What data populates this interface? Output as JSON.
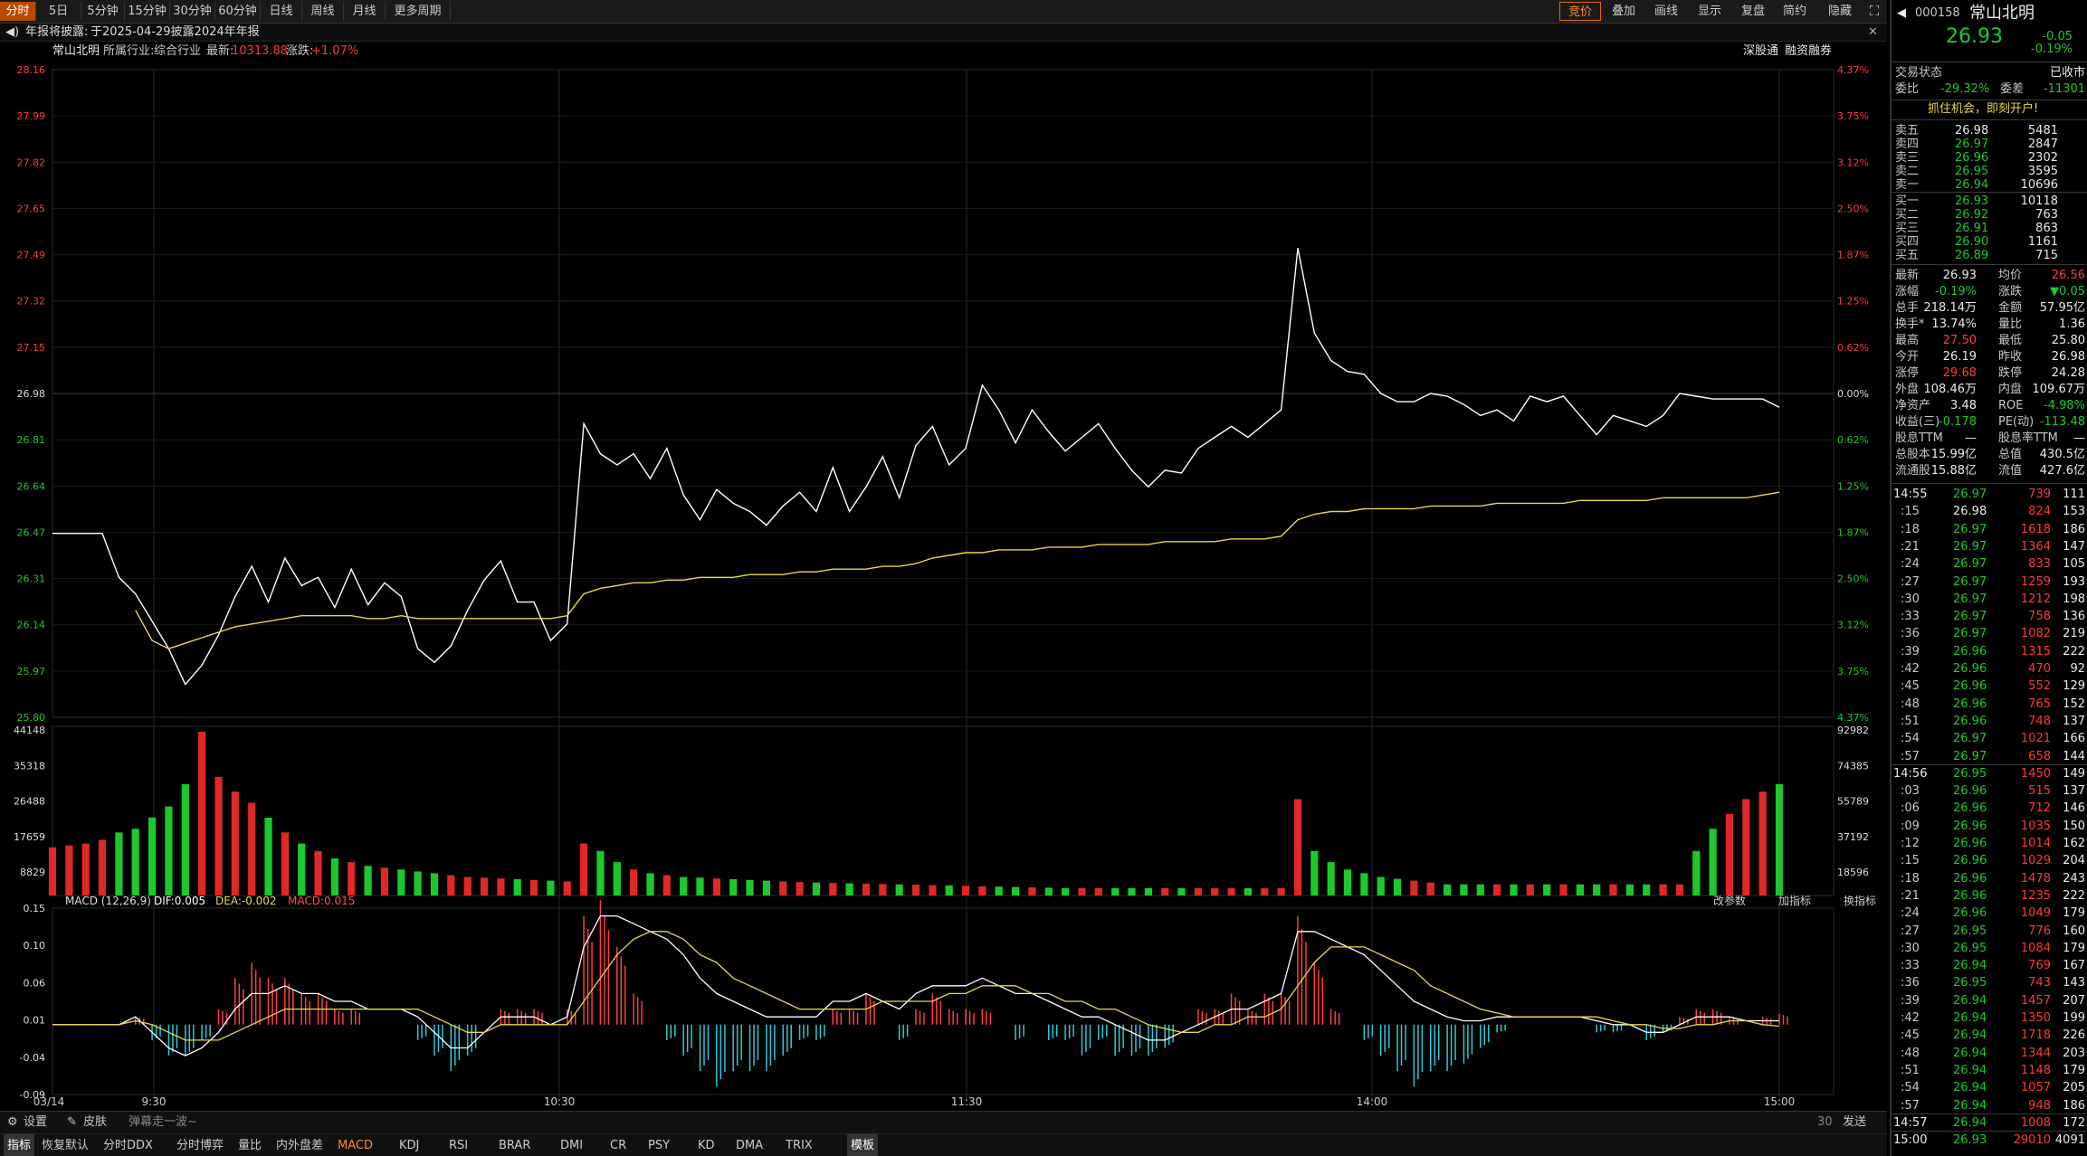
{
  "toolbar": {
    "tabs": [
      "分时",
      "5日",
      "5分钟",
      "15分钟",
      "30分钟",
      "60分钟",
      "日线",
      "周线",
      "月线",
      "更多周期"
    ],
    "right": [
      "竞价",
      "叠加",
      "画线",
      "显示",
      "复盘",
      "简约",
      "隐藏"
    ]
  },
  "notice": {
    "label": "年报将披露:",
    "text": "于2025-04-29披露2024年年报"
  },
  "info": {
    "name": "常山北明",
    "industry_label": "所属行业:",
    "industry": "综合行业",
    "latest_label": "最新:",
    "latest": "10313.88",
    "change_label": "涨跌:",
    "change": "+1.07%",
    "links": [
      "深股通",
      "融资融券"
    ]
  },
  "chart_data": [
    {
      "type": "line",
      "title": "",
      "y_labels": [
        "28.16",
        "27.99",
        "27.82",
        "27.65",
        "27.49",
        "27.32",
        "27.15",
        "26.98",
        "26.81",
        "26.64",
        "26.47",
        "26.31",
        "26.14",
        "25.97",
        "25.80"
      ],
      "pct_labels": [
        "4.37%",
        "3.75%",
        "3.12%",
        "2.50%",
        "1.87%",
        "1.25%",
        "0.62%",
        "0.00%",
        "0.62%",
        "1.25%",
        "1.87%",
        "2.50%",
        "3.12%",
        "3.75%",
        "4.37%"
      ],
      "ylim": [
        25.8,
        28.16
      ],
      "prev_close": 26.98,
      "x_labels": [
        "03/14",
        "9:30",
        "10:30",
        "11:30",
        "14:00",
        "15:00"
      ],
      "series": [
        {
          "name": "",
          "color": "#ffffff",
          "values": [
            26.47,
            26.47,
            26.47,
            26.47,
            26.31,
            26.25,
            26.15,
            26.05,
            25.92,
            25.99,
            26.1,
            26.24,
            26.35,
            26.22,
            26.38,
            26.28,
            26.31,
            26.2,
            26.34,
            26.21,
            26.29,
            26.24,
            26.05,
            26.0,
            26.06,
            26.19,
            26.3,
            26.37,
            26.22,
            26.22,
            26.08,
            26.14,
            26.87,
            26.76,
            26.72,
            26.76,
            26.67,
            26.78,
            26.61,
            26.52,
            26.63,
            26.58,
            26.55,
            26.5,
            26.57,
            26.62,
            26.55,
            26.71,
            26.55,
            26.64,
            26.75,
            26.6,
            26.79,
            26.86,
            26.72,
            26.78,
            27.01,
            26.92,
            26.8,
            26.92,
            26.84,
            26.77,
            26.82,
            26.87,
            26.78,
            26.7,
            26.64,
            26.7,
            26.69,
            26.78,
            26.82,
            26.86,
            26.82,
            26.87,
            26.92,
            27.51,
            27.2,
            27.1,
            27.06,
            27.05,
            26.98,
            26.95,
            26.95,
            26.98,
            26.97,
            26.94,
            26.9,
            26.92,
            26.88,
            26.97,
            26.95,
            26.97,
            26.9,
            26.83,
            26.9,
            26.88,
            26.86,
            26.9,
            26.98,
            26.97,
            26.96,
            26.96,
            26.96,
            26.96,
            26.93
          ]
        },
        {
          "name": "",
          "color": "#e8d84a",
          "values": [
            null,
            null,
            null,
            null,
            null,
            26.19,
            26.08,
            26.05,
            26.07,
            26.09,
            26.11,
            26.13,
            26.14,
            26.15,
            26.16,
            26.17,
            26.17,
            26.17,
            26.17,
            26.16,
            26.16,
            26.17,
            26.16,
            26.16,
            26.16,
            26.16,
            26.16,
            26.16,
            26.16,
            26.16,
            26.16,
            26.17,
            26.25,
            26.27,
            26.28,
            26.29,
            26.29,
            26.3,
            26.3,
            26.31,
            26.31,
            26.31,
            26.32,
            26.32,
            26.32,
            26.33,
            26.33,
            26.34,
            26.34,
            26.34,
            26.35,
            26.35,
            26.36,
            26.38,
            26.39,
            26.4,
            26.4,
            26.41,
            26.41,
            26.41,
            26.42,
            26.42,
            26.42,
            26.43,
            26.43,
            26.43,
            26.43,
            26.44,
            26.44,
            26.44,
            26.44,
            26.45,
            26.45,
            26.45,
            26.46,
            26.52,
            26.54,
            26.55,
            26.55,
            26.56,
            26.56,
            26.56,
            26.56,
            26.57,
            26.57,
            26.57,
            26.57,
            26.58,
            26.58,
            26.58,
            26.58,
            26.58,
            26.59,
            26.59,
            26.59,
            26.59,
            26.59,
            26.6,
            26.6,
            26.6,
            26.6,
            26.6,
            26.6,
            26.61,
            26.62
          ]
        }
      ]
    },
    {
      "type": "bar",
      "title": "",
      "y_labels": [
        "44148",
        "35318",
        "26488",
        "17659",
        "8829"
      ],
      "right_labels": [
        "92982",
        "74385",
        "55789",
        "37192",
        "18596"
      ],
      "ylim": [
        0,
        44148
      ],
      "values": [
        13000,
        13500,
        14000,
        15000,
        17000,
        18000,
        21000,
        24000,
        30000,
        44148,
        32000,
        28000,
        25000,
        21000,
        17000,
        14000,
        12000,
        10000,
        9000,
        8000,
        7500,
        7000,
        6500,
        6000,
        5500,
        5000,
        4800,
        4600,
        4400,
        4200,
        4000,
        3800,
        14000,
        12000,
        9000,
        7000,
        6000,
        5500,
        5000,
        4800,
        4600,
        4400,
        4200,
        4000,
        3800,
        3600,
        3500,
        3400,
        3300,
        3200,
        3100,
        3000,
        2900,
        2800,
        2700,
        2600,
        2500,
        2400,
        2300,
        2200,
        2100,
        2000,
        2000,
        2000,
        2000,
        2000,
        2000,
        2000,
        2000,
        2000,
        2000,
        2000,
        2000,
        2000,
        2000,
        26000,
        12000,
        9000,
        7000,
        6000,
        5000,
        4500,
        4000,
        3500,
        3000,
        3000,
        3000,
        3000,
        3000,
        3000,
        3000,
        3000,
        3000,
        3000,
        3000,
        3000,
        3000,
        3000,
        3000,
        12000,
        18000,
        22000,
        26000,
        28000,
        30000
      ]
    },
    {
      "type": "line",
      "title": "MACD (12,26,9)",
      "legend": {
        "dif": "DIF:0.005",
        "dea": "DEA:-0.002",
        "macd": "MACD:0.015"
      },
      "y_labels": [
        "0.15",
        "0.10",
        "0.06",
        "0.01",
        "-0.04",
        "-0.09"
      ],
      "ylim": [
        -0.09,
        0.15
      ],
      "dif": [
        0,
        0,
        0,
        0,
        0,
        0.01,
        -0.01,
        -0.03,
        -0.04,
        -0.03,
        -0.01,
        0.02,
        0.04,
        0.04,
        0.05,
        0.04,
        0.04,
        0.03,
        0.03,
        0.02,
        0.02,
        0.02,
        0.01,
        -0.01,
        -0.03,
        -0.03,
        -0.01,
        0.01,
        0.01,
        0.01,
        0,
        0.01,
        0.1,
        0.14,
        0.14,
        0.13,
        0.12,
        0.11,
        0.09,
        0.06,
        0.04,
        0.03,
        0.02,
        0.01,
        0.01,
        0.01,
        0.01,
        0.03,
        0.03,
        0.04,
        0.03,
        0.02,
        0.04,
        0.05,
        0.05,
        0.05,
        0.06,
        0.05,
        0.04,
        0.04,
        0.03,
        0.02,
        0.01,
        0.01,
        0,
        -0.01,
        -0.02,
        -0.02,
        -0.01,
        0,
        0.01,
        0.02,
        0.02,
        0.03,
        0.04,
        0.12,
        0.12,
        0.11,
        0.1,
        0.09,
        0.07,
        0.05,
        0.03,
        0.02,
        0.01,
        0.005,
        0.005,
        0.01,
        0.01,
        0.01,
        0.01,
        0.01,
        0.01,
        0.005,
        0,
        0,
        -0.01,
        -0.01,
        0,
        0.01,
        0.01,
        0.01,
        0.005,
        0.005,
        0.005
      ],
      "dea": [
        0,
        0,
        0,
        0,
        0,
        0.005,
        0,
        -0.01,
        -0.02,
        -0.02,
        -0.02,
        -0.01,
        0,
        0.01,
        0.02,
        0.02,
        0.02,
        0.02,
        0.02,
        0.02,
        0.02,
        0.02,
        0.02,
        0.01,
        0,
        -0.01,
        -0.01,
        0,
        0,
        0,
        0,
        0,
        0.03,
        0.06,
        0.09,
        0.11,
        0.12,
        0.12,
        0.11,
        0.09,
        0.08,
        0.06,
        0.05,
        0.04,
        0.03,
        0.02,
        0.02,
        0.02,
        0.02,
        0.02,
        0.03,
        0.03,
        0.03,
        0.03,
        0.04,
        0.04,
        0.05,
        0.05,
        0.05,
        0.04,
        0.04,
        0.03,
        0.03,
        0.02,
        0.02,
        0.01,
        0,
        -0.005,
        -0.01,
        -0.01,
        0,
        0,
        0.01,
        0.01,
        0.02,
        0.05,
        0.08,
        0.1,
        0.1,
        0.1,
        0.09,
        0.08,
        0.07,
        0.05,
        0.04,
        0.03,
        0.02,
        0.015,
        0.01,
        0.01,
        0.01,
        0.01,
        0.01,
        0.01,
        0.005,
        0,
        0,
        -0.005,
        -0.005,
        0,
        0,
        0.005,
        0.005,
        0,
        -0.002
      ]
    }
  ],
  "bottom": {
    "row1": [
      "设置",
      "皮肤"
    ],
    "ticker_text": "弹幕走一波~",
    "count": "30",
    "send": "发送",
    "tabs": [
      "指标",
      "恢复默认",
      "分时DDX",
      "分时博弈",
      "量比",
      "内外盘差",
      "MACD",
      "KDJ",
      "RSI",
      "BRAR",
      "DMI",
      "CR",
      "PSY",
      "KD",
      "DMA",
      "TRIX",
      "模板"
    ],
    "macd_buttons": [
      "改参数",
      "加指标",
      "换指标"
    ]
  },
  "side": {
    "code": "000158",
    "name": "常山北明",
    "price": "26.93",
    "change": "-0.05",
    "pct": "-0.19%",
    "status_label": "交易状态",
    "status": "已收市",
    "wb_label": "委比",
    "wb": "-29.32%",
    "wc_label": "委差",
    "wc": "-11301",
    "promo": "抓住机会，即刻开户!",
    "asks": [
      {
        "l": "卖五",
        "p": "26.98",
        "v": "5481"
      },
      {
        "l": "卖四",
        "p": "26.97",
        "v": "2847"
      },
      {
        "l": "卖三",
        "p": "26.96",
        "v": "2302"
      },
      {
        "l": "卖二",
        "p": "26.95",
        "v": "3595"
      },
      {
        "l": "卖一",
        "p": "26.94",
        "v": "10696"
      }
    ],
    "bids": [
      {
        "l": "买一",
        "p": "26.93",
        "v": "10118"
      },
      {
        "l": "买二",
        "p": "26.92",
        "v": "763"
      },
      {
        "l": "买三",
        "p": "26.91",
        "v": "863"
      },
      {
        "l": "买四",
        "p": "26.90",
        "v": "1161"
      },
      {
        "l": "买五",
        "p": "26.89",
        "v": "715"
      }
    ],
    "stats": [
      [
        "最新",
        "26.93",
        "均价",
        "26.56"
      ],
      [
        "涨幅",
        "-0.19%",
        "涨跌",
        "▼0.05"
      ],
      [
        "总手",
        "218.14万",
        "金额",
        "57.95亿"
      ],
      [
        "换手*",
        "13.74%",
        "量比",
        "1.36"
      ],
      [
        "最高",
        "27.50",
        "最低",
        "25.80"
      ],
      [
        "今开",
        "26.19",
        "昨收",
        "26.98"
      ],
      [
        "涨停",
        "29.68",
        "跌停",
        "24.28"
      ],
      [
        "外盘",
        "108.46万",
        "内盘",
        "109.67万"
      ],
      [
        "净资产",
        "3.48",
        "ROE",
        "-4.98%"
      ],
      [
        "收益(三)",
        "-0.178",
        "PE(动)",
        "-113.48"
      ],
      [
        "股息TTM",
        "—",
        "股息率TTM",
        "—"
      ],
      [
        "总股本",
        "15.99亿",
        "总值",
        "430.5亿"
      ],
      [
        "流通股",
        "15.88亿",
        "流值",
        "427.6亿"
      ]
    ],
    "trades": [
      [
        "14:55",
        "26.97",
        "739",
        "111"
      ],
      [
        ":15",
        "26.98",
        "824",
        "153"
      ],
      [
        ":18",
        "26.97",
        "1618",
        "186"
      ],
      [
        ":21",
        "26.97",
        "1364",
        "147"
      ],
      [
        ":24",
        "26.97",
        "833",
        "105"
      ],
      [
        ":27",
        "26.97",
        "1259",
        "193"
      ],
      [
        ":30",
        "26.97",
        "1212",
        "198"
      ],
      [
        ":33",
        "26.97",
        "758",
        "136"
      ],
      [
        ":36",
        "26.97",
        "1082",
        "219"
      ],
      [
        ":39",
        "26.96",
        "1315",
        "222"
      ],
      [
        ":42",
        "26.96",
        "470",
        "92"
      ],
      [
        ":45",
        "26.96",
        "552",
        "129"
      ],
      [
        ":48",
        "26.96",
        "765",
        "152"
      ],
      [
        ":51",
        "26.96",
        "748",
        "137"
      ],
      [
        ":54",
        "26.97",
        "1021",
        "166"
      ],
      [
        ":57",
        "26.97",
        "658",
        "144"
      ],
      [
        "14:56",
        "26.95",
        "1450",
        "149"
      ],
      [
        ":03",
        "26.96",
        "515",
        "137"
      ],
      [
        ":06",
        "26.96",
        "712",
        "146"
      ],
      [
        ":09",
        "26.96",
        "1035",
        "150"
      ],
      [
        ":12",
        "26.96",
        "1014",
        "162"
      ],
      [
        ":15",
        "26.96",
        "1029",
        "204"
      ],
      [
        ":18",
        "26.96",
        "1478",
        "243"
      ],
      [
        ":21",
        "26.96",
        "1235",
        "222"
      ],
      [
        ":24",
        "26.96",
        "1049",
        "179"
      ],
      [
        ":27",
        "26.95",
        "776",
        "160"
      ],
      [
        ":30",
        "26.95",
        "1084",
        "179"
      ],
      [
        ":33",
        "26.94",
        "769",
        "167"
      ],
      [
        ":36",
        "26.95",
        "743",
        "143"
      ],
      [
        ":39",
        "26.94",
        "1457",
        "207"
      ],
      [
        ":42",
        "26.94",
        "1350",
        "199"
      ],
      [
        ":45",
        "26.94",
        "1718",
        "226"
      ],
      [
        ":48",
        "26.94",
        "1344",
        "203"
      ],
      [
        ":51",
        "26.94",
        "1148",
        "179"
      ],
      [
        ":54",
        "26.94",
        "1057",
        "205"
      ],
      [
        ":57",
        "26.94",
        "948",
        "186"
      ],
      [
        "14:57",
        "26.94",
        "1008",
        "172"
      ],
      [
        "15:00",
        "26.93",
        "29010",
        "4091"
      ]
    ]
  }
}
